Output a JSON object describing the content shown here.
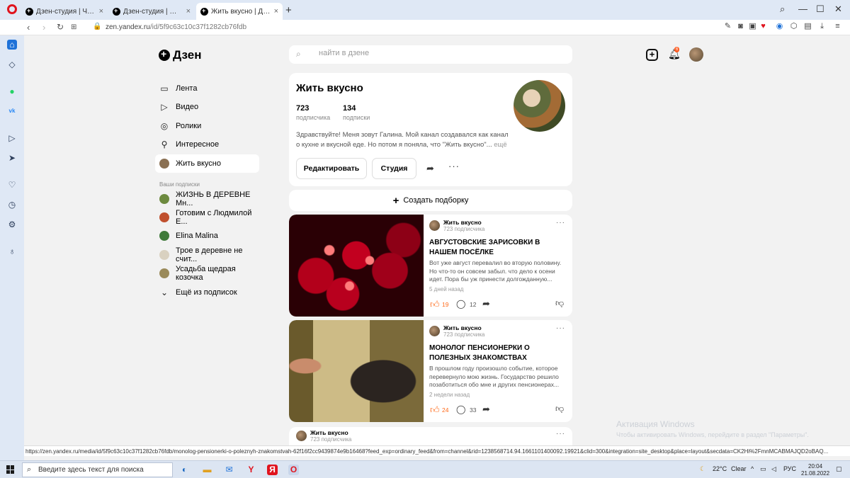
{
  "browser": {
    "tabs": [
      {
        "label": "Дзен-студия | Черновик |"
      },
      {
        "label": "Дзен-студия | Жить вкусн"
      },
      {
        "label": "Жить вкусно | Дзен"
      }
    ],
    "url_host": "zen.yandex.ru",
    "url_path": "/id/5f9c63c10c37f1282cb76fdb",
    "status_url": "https://zen.yandex.ru/media/id/5f9c63c10c37f1282cb76fdb/monolog-pensionerki-o-poleznyh-znakomstvah-62f16f2cc9439874e9b16468?feed_exp=ordinary_feed&from=channel&rid=1238568714.94.1661101400092.19921&clid=300&integration=site_desktop&place=layout&secdata=CK2Hi%2FmnMCABMAJQD2oBAQ..."
  },
  "header": {
    "logo": "Дзен",
    "search_placeholder": "найти в дзене",
    "notif_count": "6"
  },
  "nav": {
    "items": [
      {
        "label": "Лента",
        "icon": "feed-icon"
      },
      {
        "label": "Видео",
        "icon": "play-icon"
      },
      {
        "label": "Ролики",
        "icon": "shorts-icon"
      },
      {
        "label": "Интересное",
        "icon": "rocket-icon"
      },
      {
        "label": "Жить вкусно",
        "icon": "avatar"
      }
    ],
    "subs_title": "Ваши подписки",
    "subs": [
      {
        "label": "ЖИЗНЬ В ДЕРЕВНЕ Мн..."
      },
      {
        "label": "Готовим с Людмилой Е..."
      },
      {
        "label": "Elina Malina"
      },
      {
        "label": "Трое в деревне не счит..."
      },
      {
        "label": "Усадьба щедрая козочка"
      }
    ],
    "more_label": "Ещё из подписок"
  },
  "channel": {
    "title": "Жить вкусно",
    "subscribers_num": "723",
    "subscribers_lbl": "подписчика",
    "subscriptions_num": "134",
    "subscriptions_lbl": "подписки",
    "description": "Здравствуйте! Меня зовут Галина. Мой канал создавался как канал о кухне и вкусной еде. Но потом я поняла, что \"Жить вкусно\"...",
    "more": "ещё",
    "edit_label": "Редактировать",
    "studio_label": "Студия"
  },
  "create_label": "Создать подборку",
  "posts": [
    {
      "author": "Жить вкусно",
      "subs": "723 подписчика",
      "title": "АВГУСТОВСКИЕ ЗАРИСОВКИ В НАШЕМ ПОСЁЛКЕ",
      "text": "Вот уже август перевалил во вторую половину. Но что-то он совсем забыл. что дело к осени идет. Пора бы уж принести долгожданную...",
      "date": "5 дней назад",
      "likes": "19",
      "comments": "12"
    },
    {
      "author": "Жить вкусно",
      "subs": "723 подписчика",
      "title": "МОНОЛОГ ПЕНСИОНЕРКИ О ПОЛЕЗНЫХ ЗНАКОМСТВАХ",
      "text": "В прошлом году произошло событие, которое перевернуло мою жизнь. Государство решило позаботиться обо мне и других пенсионерах...",
      "date": "2 недели назад",
      "likes": "24",
      "comments": "33"
    },
    {
      "author": "Жить вкусно",
      "subs": "723 подписчика"
    }
  ],
  "windows": {
    "activation_title": "Активация Windows",
    "activation_text": "Чтобы активировать Windows, перейдите в раздел \"Параметры\".",
    "search_placeholder": "Введите здесь текст для поиска",
    "temp": "22°C",
    "weather": "Clear",
    "lang": "РУС",
    "time": "20:04",
    "date": "21.08.2022"
  },
  "colors": {
    "accent": "#ff6a1a",
    "chrome": "#dfe8f5",
    "background": "#f2f2f2"
  }
}
